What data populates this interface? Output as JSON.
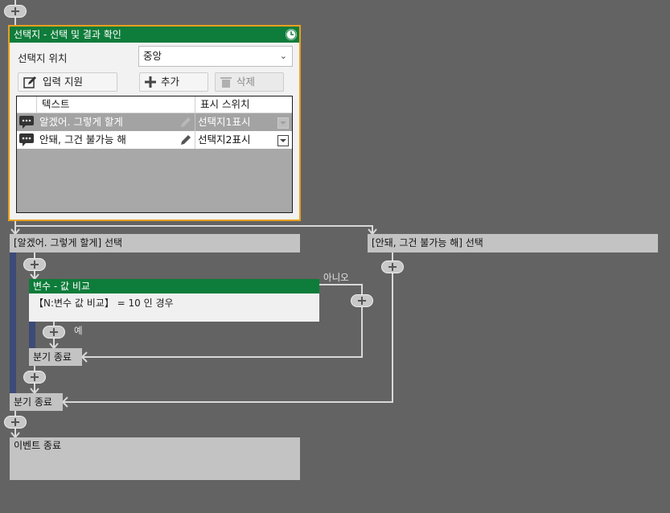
{
  "choice_panel": {
    "title": "선택지 - 선택 및 결과 확인",
    "position_label": "선택지 위치",
    "position_value": "중앙",
    "buttons": {
      "input_help": "입력 지원",
      "add": "추가",
      "delete": "삭제"
    },
    "columns": {
      "text": "텍스트",
      "switch": "표시 스위치"
    },
    "rows": [
      {
        "text": "알겠어. 그렇게 할게",
        "switch": "선택지1표시",
        "selected": true
      },
      {
        "text": "안돼, 그건 불가능 해",
        "switch": "선택지2표시",
        "selected": false
      }
    ]
  },
  "branches": {
    "left": "[알겠어. 그렇게 할게] 선택",
    "right": "[안돼, 그건 불가능 해] 선택"
  },
  "condition": {
    "title": "변수 - 값 비교",
    "body": "【N:변수 값 비교】 = 10 인 경우",
    "no_label": "아니오",
    "yes_label": "예"
  },
  "branch_end_inner": "분기 종료",
  "branch_end_outer": "분기 종료",
  "event_end": "이벤트 종료",
  "colors": {
    "header_green": "#0e7c3a",
    "selection_border": "#e8a020",
    "canvas": "#636363"
  },
  "icons": [
    "plus-icon",
    "clock-icon",
    "edit-icon",
    "trash-icon",
    "chevron-down-icon",
    "speech-icon",
    "pencil-icon",
    "dropdown-icon"
  ]
}
